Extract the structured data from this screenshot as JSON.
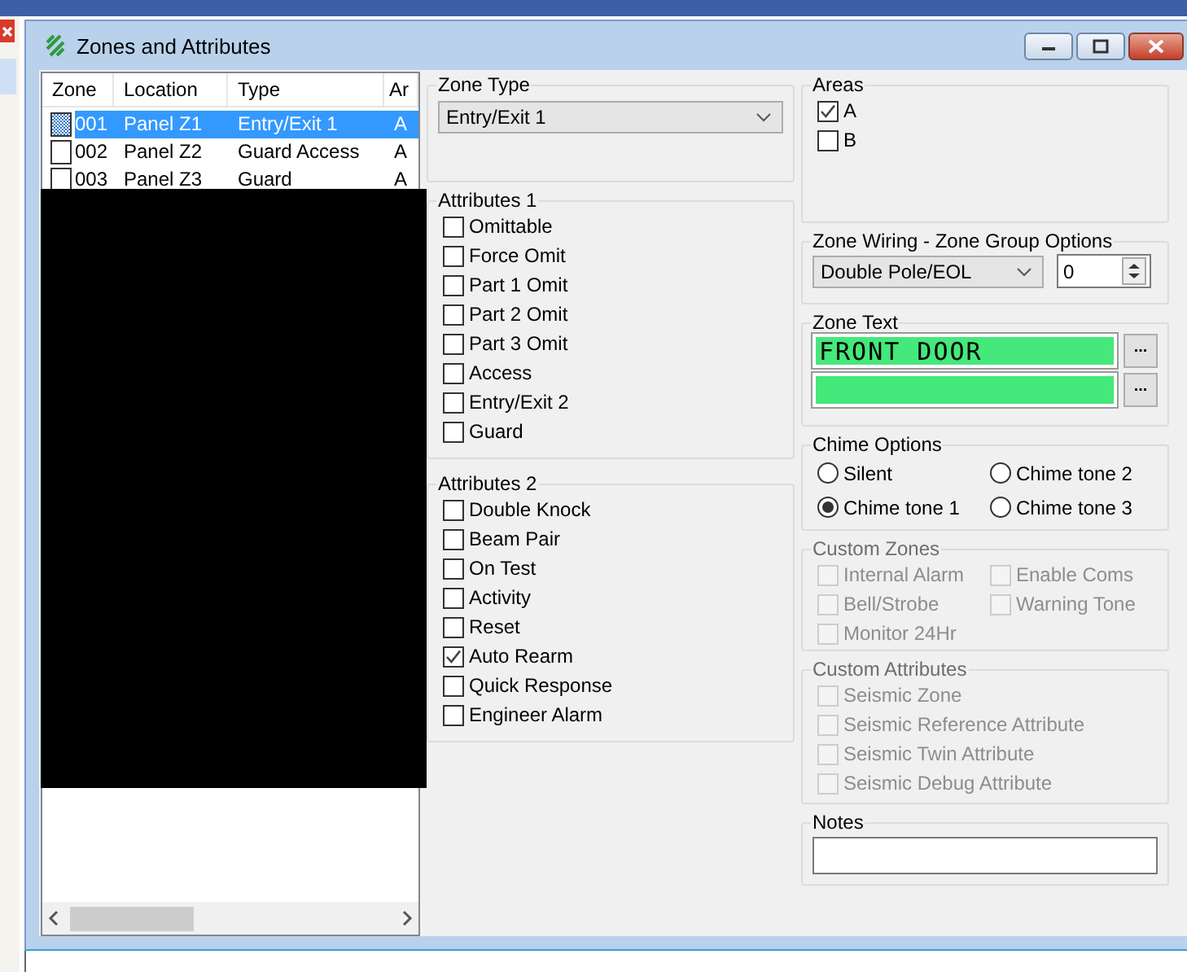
{
  "window": {
    "title": "Zones and Attributes"
  },
  "zone_list": {
    "columns": [
      "Zone",
      "Location",
      "Type",
      "Ar"
    ],
    "rows": [
      {
        "zone": "001",
        "location": "Panel Z1",
        "type": "Entry/Exit 1",
        "area": "A",
        "selected": true
      },
      {
        "zone": "002",
        "location": "Panel Z2",
        "type": "Guard Access",
        "area": "A",
        "selected": false
      },
      {
        "zone": "003",
        "location": "Panel Z3",
        "type": "Guard",
        "area": "A",
        "selected": false
      }
    ]
  },
  "zone_type": {
    "label": "Zone Type",
    "value": "Entry/Exit 1"
  },
  "attributes_1": {
    "label": "Attributes 1",
    "items": [
      {
        "label": "Omittable",
        "checked": false
      },
      {
        "label": "Force Omit",
        "checked": false
      },
      {
        "label": "Part 1 Omit",
        "checked": false
      },
      {
        "label": "Part 2 Omit",
        "checked": false
      },
      {
        "label": "Part 3 Omit",
        "checked": false
      },
      {
        "label": "Access",
        "checked": false
      },
      {
        "label": "Entry/Exit 2",
        "checked": false
      },
      {
        "label": "Guard",
        "checked": false
      }
    ]
  },
  "attributes_2": {
    "label": "Attributes 2",
    "items": [
      {
        "label": "Double Knock",
        "checked": false
      },
      {
        "label": "Beam Pair",
        "checked": false
      },
      {
        "label": "On Test",
        "checked": false
      },
      {
        "label": "Activity",
        "checked": false
      },
      {
        "label": "Reset",
        "checked": false
      },
      {
        "label": "Auto Rearm",
        "checked": true
      },
      {
        "label": "Quick Response",
        "checked": false
      },
      {
        "label": "Engineer Alarm",
        "checked": false
      }
    ]
  },
  "areas": {
    "label": "Areas",
    "items": [
      {
        "label": "A",
        "checked": true
      },
      {
        "label": "B",
        "checked": false
      }
    ]
  },
  "zone_wiring": {
    "label": "Zone Wiring - Zone Group Options",
    "value": "Double Pole/EOL",
    "group": "0"
  },
  "zone_text": {
    "label": "Zone Text",
    "lines": [
      {
        "text": "FRONT DOOR",
        "button": "..."
      },
      {
        "button": "..."
      }
    ]
  },
  "chime_options": {
    "label": "Chime Options",
    "options": [
      {
        "label": "Silent",
        "selected": false
      },
      {
        "label": "Chime tone 2",
        "selected": false
      },
      {
        "label": "Chime tone 1",
        "selected": true
      },
      {
        "label": "Chime tone 3",
        "selected": false
      }
    ]
  },
  "custom_zones": {
    "label": "Custom Zones",
    "disabled": true,
    "items": [
      {
        "label": "Internal Alarm",
        "checked": false
      },
      {
        "label": "Enable Coms",
        "checked": false
      },
      {
        "label": "Bell/Strobe",
        "checked": false
      },
      {
        "label": "Warning Tone",
        "checked": false
      },
      {
        "label": "Monitor 24Hr",
        "checked": false
      }
    ]
  },
  "custom_attributes": {
    "label": "Custom Attributes",
    "disabled": true,
    "items": [
      {
        "label": "Seismic Zone",
        "checked": false
      },
      {
        "label": "Seismic Reference Attribute",
        "checked": false
      },
      {
        "label": "Seismic Twin Attribute",
        "checked": false
      },
      {
        "label": "Seismic Debug Attribute",
        "checked": false
      }
    ]
  },
  "notes": {
    "label": "Notes"
  }
}
